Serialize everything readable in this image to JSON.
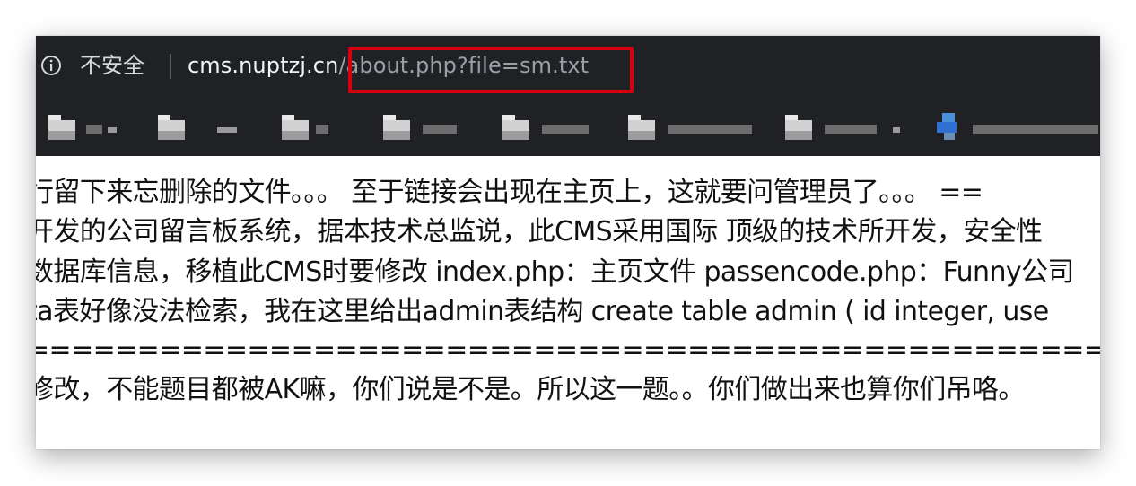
{
  "browser": {
    "security_label": "不安全",
    "url_host": "cms.nuptzj.cn",
    "url_path": "/about.php?file=sm.txt",
    "highlight_color": "#d6000f",
    "icons": {
      "info": "info-circle-icon",
      "bookmark_folder": "folder-icon"
    },
    "bookmarks_note": "bookmark bar entries are pixelated and unreadable"
  },
  "page": {
    "lines": [
      "行留下来忘删除的文件。。。 至于链接会出现在主页上，这就要问管理员了。。。 ==",
      "开发的公司留言板系统，据本技术总监说，此CMS采用国际 顶级的技术所开发，安全性",
      "数据库信息，移植此CMS时要修改 index.php：主页文件 passencode.php：Funny公司",
      "ta表好像没法检索，我在这里给出admin表结构 create table admin ( id integer, use",
      "============================================================ 下面",
      "修改，不能题目都被AK嘛，你们说是不是。所以这一题。。你们做出来也算你们吊咯。"
    ]
  }
}
